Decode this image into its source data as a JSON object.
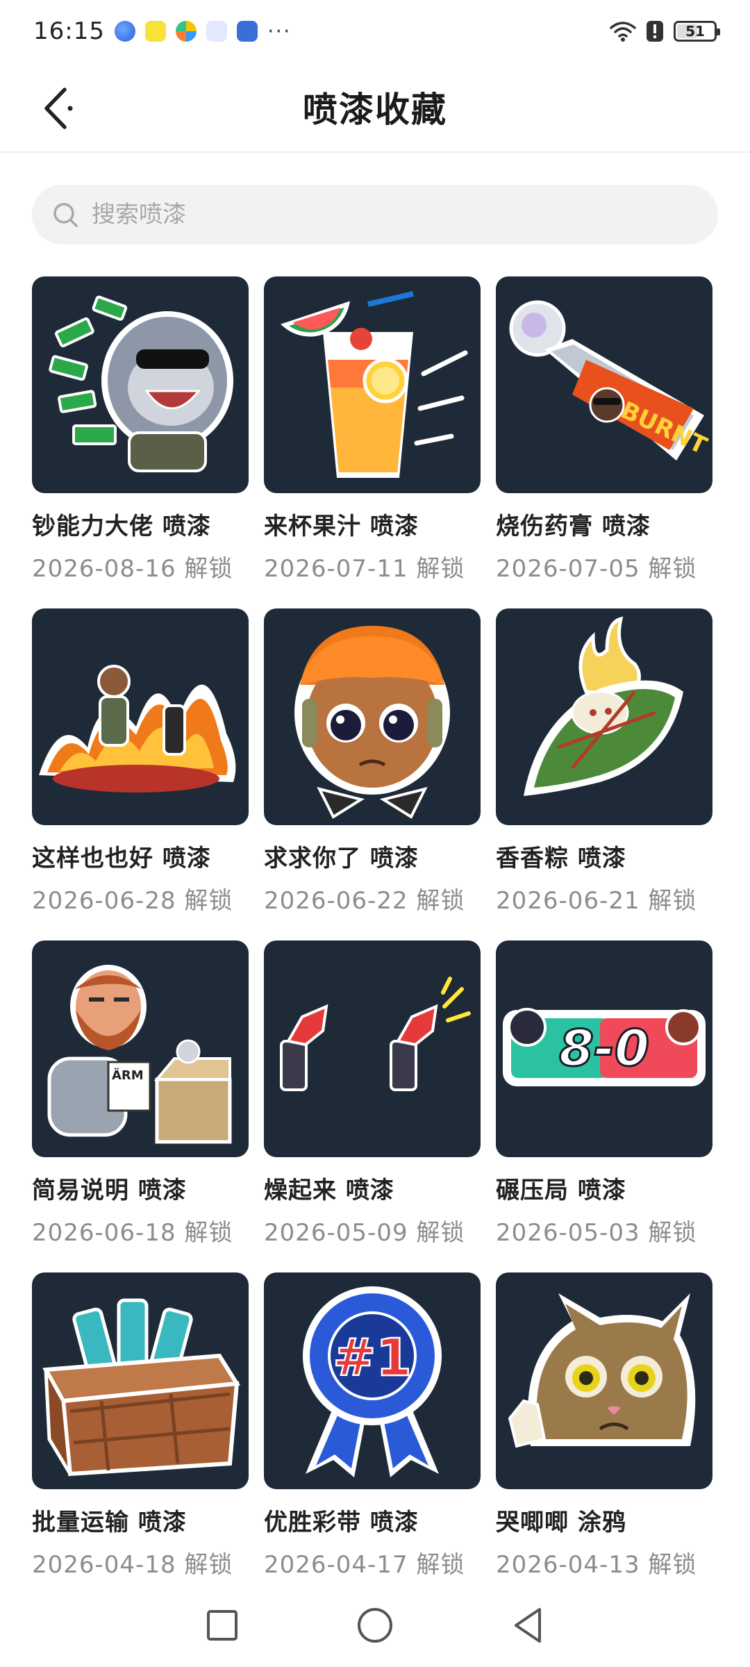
{
  "status_bar": {
    "time": "16:15",
    "more": "···",
    "battery": "51",
    "notification_icons": [
      "planet-app-icon",
      "game-app-icon",
      "pinwheel-app-icon",
      "chat-bot-app-icon",
      "shield-app-icon"
    ]
  },
  "header": {
    "title": "喷漆收藏"
  },
  "search": {
    "placeholder": "搜索喷漆",
    "value": ""
  },
  "sprays": [
    {
      "name": "钞能力大佬 喷漆",
      "date": "2026-08-16 解锁",
      "icon": "money-sloth-sticker"
    },
    {
      "name": "来杯果汁 喷漆",
      "date": "2026-07-11 解锁",
      "icon": "juice-glass-sticker"
    },
    {
      "name": "烧伤药膏 喷漆",
      "date": "2026-07-05 解锁",
      "icon": "burnt-ointment-sticker"
    },
    {
      "name": "这样也也好 喷漆",
      "date": "2026-06-28 解锁",
      "icon": "fire-agent-sticker"
    },
    {
      "name": "求求你了 喷漆",
      "date": "2026-06-22 解锁",
      "icon": "pleading-face-sticker"
    },
    {
      "name": "香香粽 喷漆",
      "date": "2026-06-21 解锁",
      "icon": "zongzi-sticker"
    },
    {
      "name": "简易说明 喷漆",
      "date": "2026-06-18 解锁",
      "icon": "bearded-reader-sticker"
    },
    {
      "name": "燥起来 喷漆",
      "date": "2026-05-09 解锁",
      "icon": "air-horn-sticker"
    },
    {
      "name": "碾压局 喷漆",
      "date": "2026-05-03 解锁",
      "icon": "scoreboard-sticker"
    },
    {
      "name": "批量运输 喷漆",
      "date": "2026-04-18 解锁",
      "icon": "crate-sticker"
    },
    {
      "name": "优胜彩带 喷漆",
      "date": "2026-04-17 解锁",
      "icon": "ribbon-sticker"
    },
    {
      "name": "哭唧唧 涂鸦",
      "date": "2026-04-13 解锁",
      "icon": "crying-cat-sticker"
    }
  ],
  "sticker_text": {
    "burnt_label": "BURNT",
    "score": "8-0",
    "ribbon_label": "#1",
    "manual_label": "ÄRM"
  },
  "colors": {
    "thumb_bg": "#1f2a38",
    "date_text": "#8c8c8c",
    "search_bg": "#f2f2f2"
  }
}
